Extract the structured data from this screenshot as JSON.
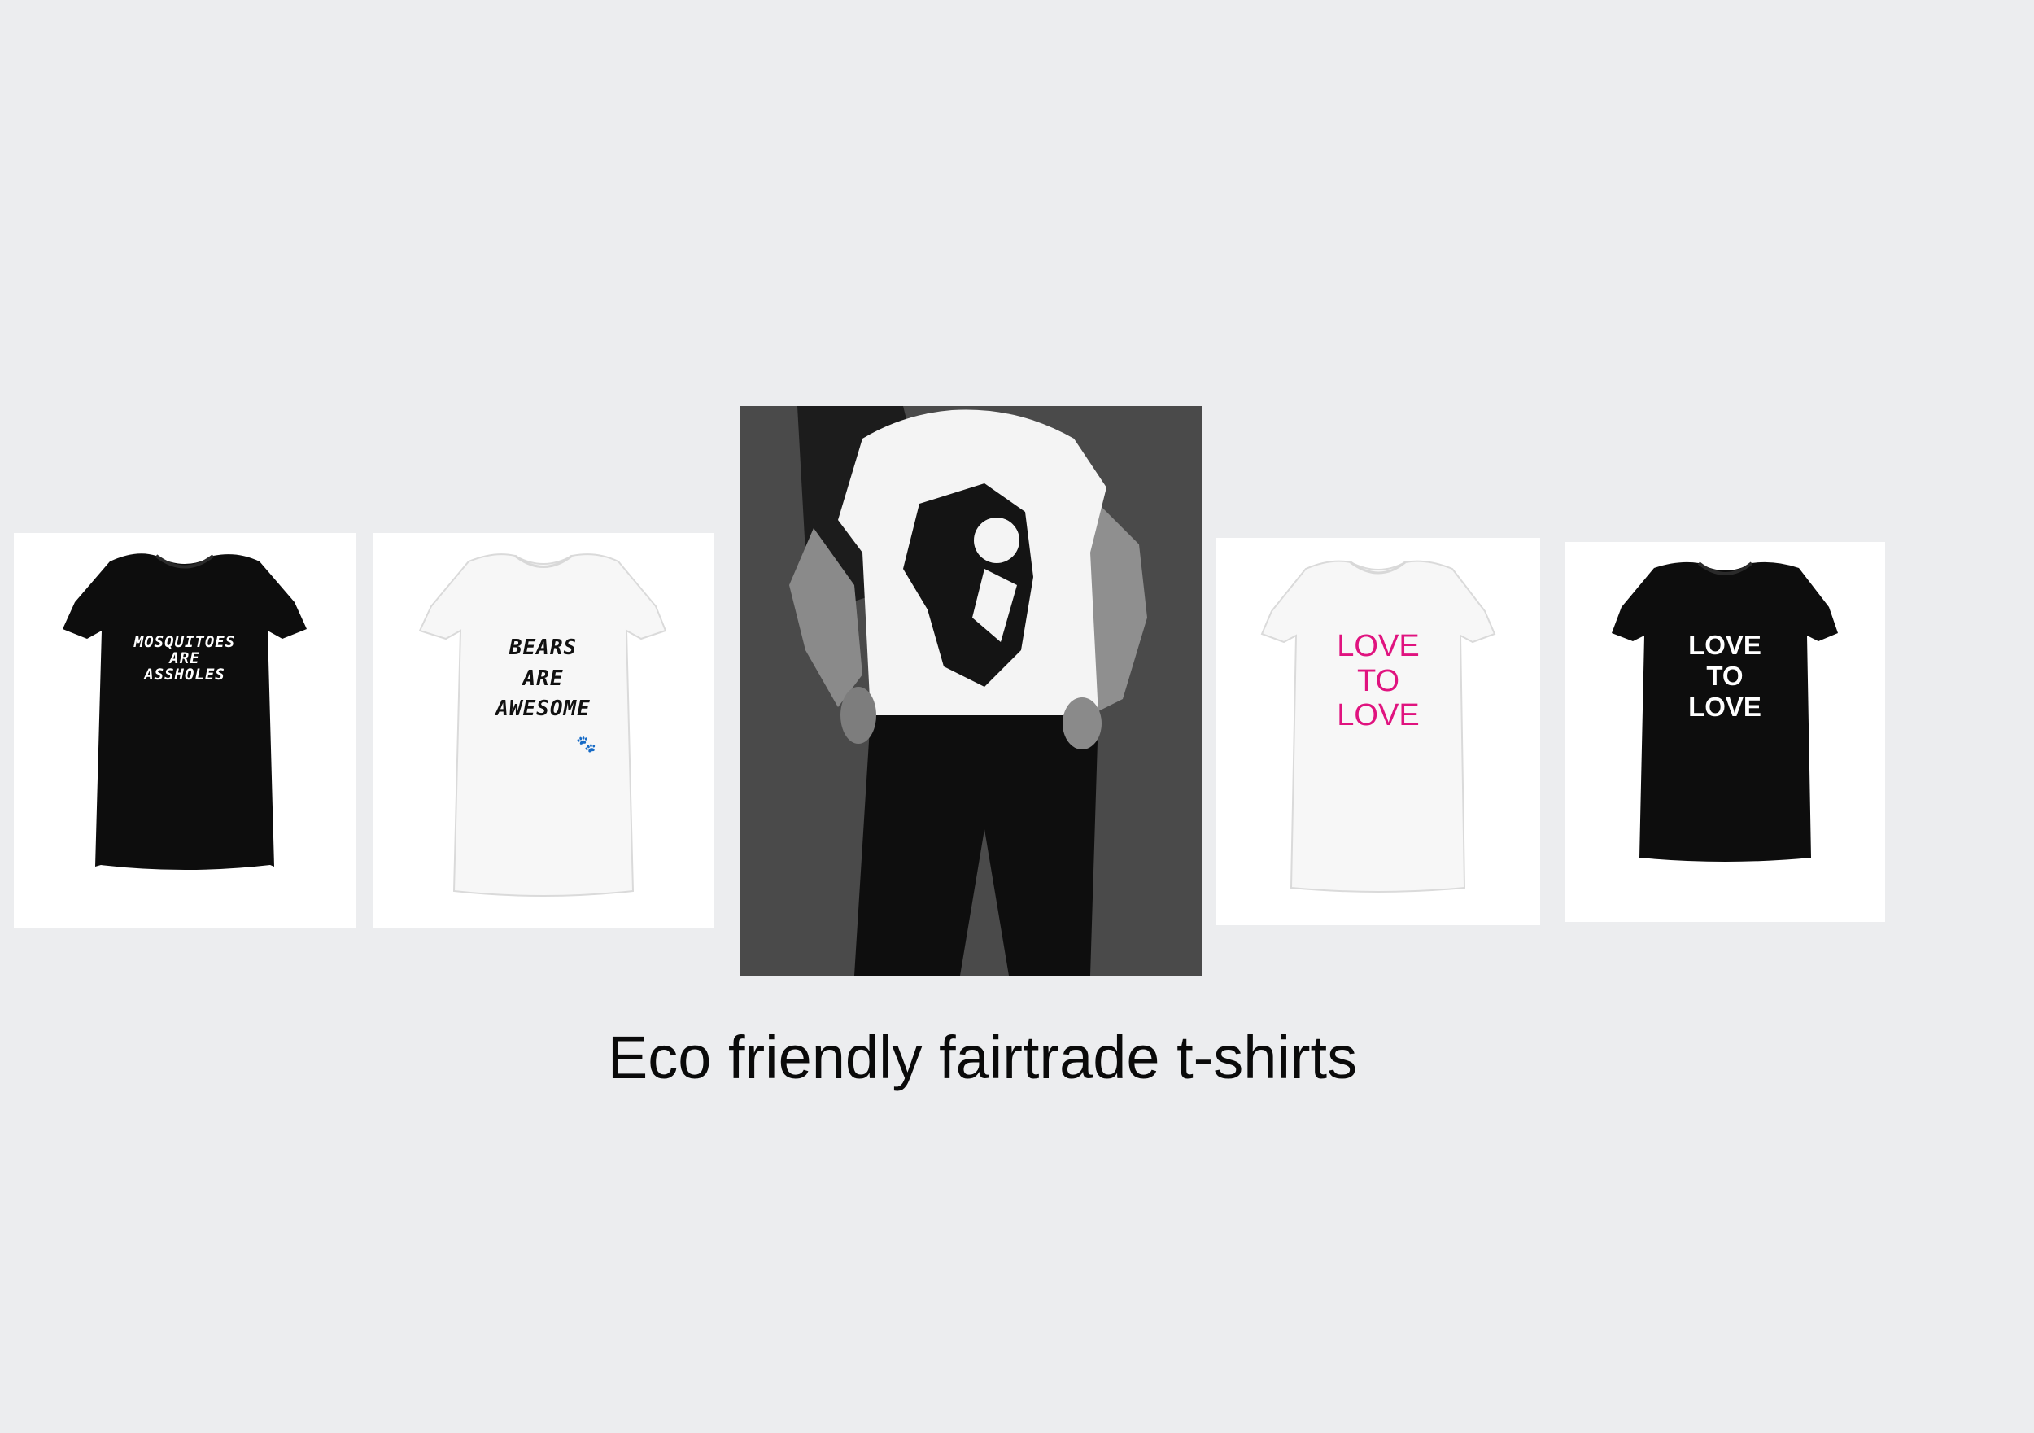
{
  "colors": {
    "background": "#ecedef",
    "black_shirt": "#0d0d0d",
    "white_shirt": "#f7f7f7",
    "photo_background": "#4a4a4a",
    "pink_text": "#e0137f"
  },
  "products": [
    {
      "shirt_color": "black",
      "slogan": "MOSQUITOES\nARE\nASSHOLES",
      "text_color": "#ffffff"
    },
    {
      "shirt_color": "white",
      "slogan": "BEARS\nARE\nAWESOME",
      "text_color": "#111111",
      "icon": "paw-icon"
    },
    {
      "type": "model-photo"
    },
    {
      "shirt_color": "white",
      "slogan": "LOVE\nTO\nLOVE",
      "text_color": "#e0137f"
    },
    {
      "shirt_color": "black",
      "slogan": "LOVE\nTO\nLOVE",
      "text_color": "#ffffff"
    }
  ],
  "caption": "Eco friendly fairtrade t-shirts"
}
